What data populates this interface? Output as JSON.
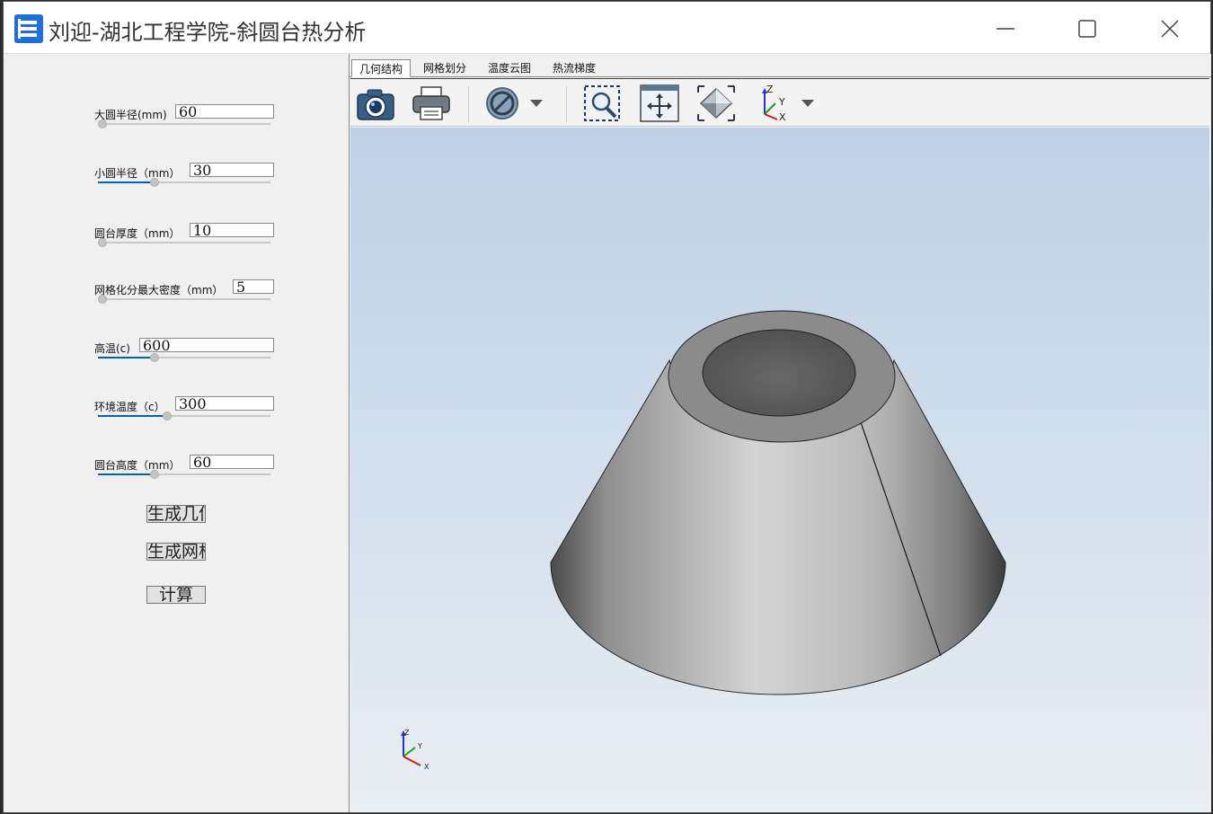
{
  "window": {
    "title": "刘迎-湖北工程学院-斜圆台热分析",
    "icon": "app-logo-icon",
    "controls": [
      "minimize-icon",
      "maximize-icon",
      "close-icon"
    ]
  },
  "params": [
    {
      "label": "大圆半径(mm)",
      "value": "60",
      "slider_fraction": 0.0
    },
    {
      "label": "小圆半径（mm）",
      "value": "30",
      "slider_fraction": 0.33
    },
    {
      "label": "圆台厚度（mm）",
      "value": "10",
      "slider_fraction": 0.0
    },
    {
      "label": "网格化分最大密度（mm）",
      "value": "5",
      "slider_fraction": 0.0
    },
    {
      "label": "高温(c)",
      "value": "600",
      "slider_fraction": 0.33
    },
    {
      "label": "环境温度（c）",
      "value": "300",
      "slider_fraction": 0.4
    },
    {
      "label": "圆台高度（mm）",
      "value": "60",
      "slider_fraction": 0.33
    }
  ],
  "buttons": {
    "gen_geometry": "生成几何",
    "gen_mesh": "生成网格",
    "compute": "计算"
  },
  "tabs": [
    "几何结构",
    "网格划分",
    "温度云图",
    "热流梯度"
  ],
  "active_tab": "几何结构",
  "toolbar": [
    "camera-icon",
    "print-icon",
    "clip-plane-icon",
    "zoom-box-icon",
    "fit-all-icon",
    "view-iso-icon",
    "axes-orientation-icon"
  ],
  "axis_labels": {
    "z": "Z",
    "y": "Y",
    "x": "X"
  },
  "colors": {
    "accent": "#0060c0",
    "viewport_top": "#bdd0e6",
    "viewport_bottom": "#e9eef3"
  }
}
